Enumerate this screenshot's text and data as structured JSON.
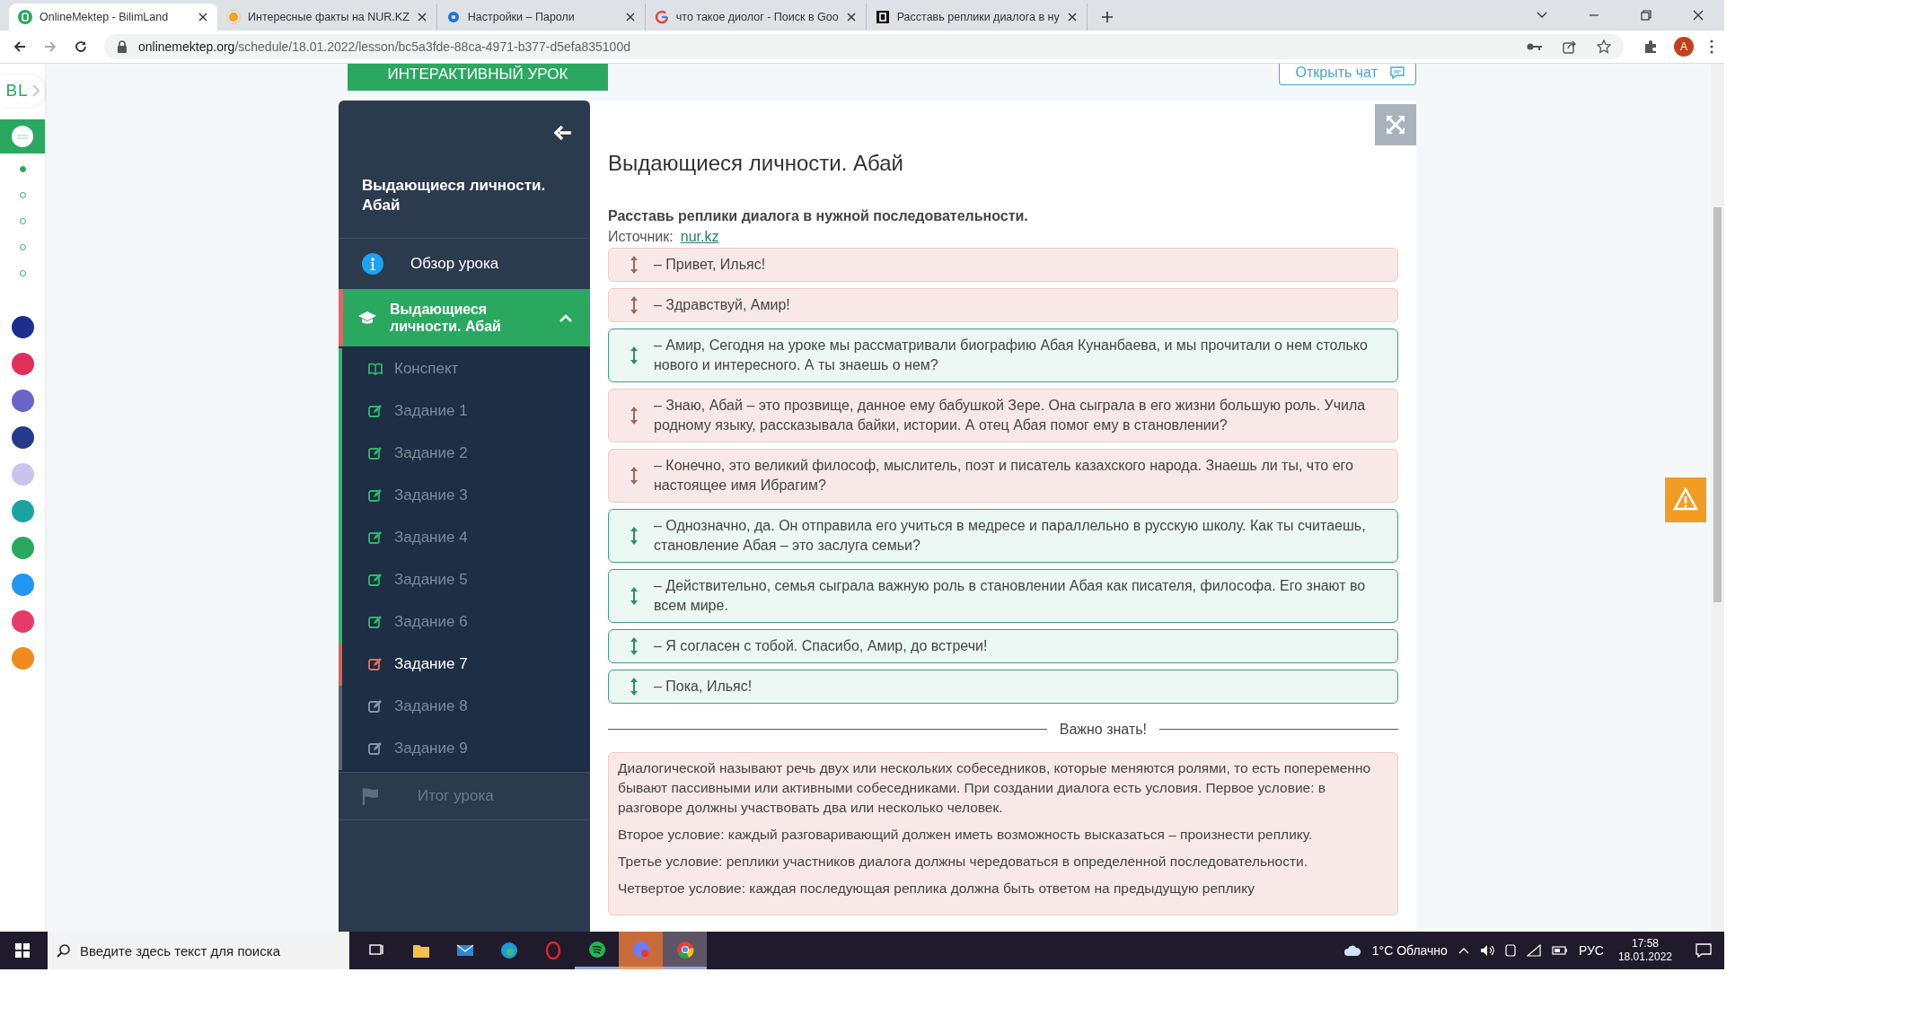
{
  "browser": {
    "tabs": [
      {
        "title": "OnlineMektep - BilimLand",
        "selected": true
      },
      {
        "title": "Интересные факты на NUR.KZ",
        "selected": false
      },
      {
        "title": "Настройки – Пароли",
        "selected": false
      },
      {
        "title": "что такое диолог - Поиск в Goo",
        "selected": false
      },
      {
        "title": "Расставь реплики диалога в ну",
        "selected": false
      }
    ],
    "url_host": "onlinemektep.org",
    "url_path": "/schedule/18.01.2022/lesson/bc5a3fde-88ca-4971-b377-d5efa835100d",
    "profile_initial": "A"
  },
  "rail": {
    "logo": "BL",
    "dots": [
      {
        "selected": true
      },
      {
        "selected": false
      },
      {
        "selected": false
      },
      {
        "selected": false
      },
      {
        "selected": false
      }
    ],
    "apps": [
      {
        "color": "#1c2f8c"
      },
      {
        "color": "#e0305a"
      },
      {
        "color": "#6a64c8"
      },
      {
        "color": "#243a8a"
      },
      {
        "color": "#c9c4ee"
      },
      {
        "color": "#1aa3a3"
      },
      {
        "color": "#2aa860"
      },
      {
        "color": "#2196f3"
      },
      {
        "color": "#e83a6a"
      },
      {
        "color": "#f08a1c"
      }
    ]
  },
  "top": {
    "interactive_button": "ИНТЕРАКТИВНЫЙ УРОК",
    "chat_button": "Открыть чат"
  },
  "sidebar": {
    "title": "Выдающиеся личности. Абай",
    "overview": "Обзор урока",
    "section": {
      "label": "Выдающиеся личности. Абай",
      "expanded": true
    },
    "items": [
      {
        "label": "Конспект",
        "kind": "notes",
        "completed": true,
        "selected": false
      },
      {
        "label": "Задание 1",
        "kind": "task",
        "completed": true,
        "selected": false
      },
      {
        "label": "Задание 2",
        "kind": "task",
        "completed": true,
        "selected": false
      },
      {
        "label": "Задание 3",
        "kind": "task",
        "completed": true,
        "selected": false
      },
      {
        "label": "Задание 4",
        "kind": "task",
        "completed": true,
        "selected": false
      },
      {
        "label": "Задание 5",
        "kind": "task",
        "completed": true,
        "selected": false
      },
      {
        "label": "Задание 6",
        "kind": "task",
        "completed": true,
        "selected": false
      },
      {
        "label": "Задание 7",
        "kind": "task",
        "completed": false,
        "selected": true
      },
      {
        "label": "Задание 8",
        "kind": "task",
        "completed": false,
        "selected": false
      },
      {
        "label": "Задание 9",
        "kind": "task",
        "completed": false,
        "selected": false
      }
    ],
    "summary": "Итог урока"
  },
  "lesson": {
    "title": "Выдающиеся личности. Абай",
    "instruction": "Расставь реплики диалога в нужной последовательности.",
    "source_label": "Источник:",
    "source_link": "nur.kz",
    "replies": [
      {
        "text": "– Привет, Ильяс!",
        "correct": false
      },
      {
        "text": "– Здравствуй, Амир!",
        "correct": false
      },
      {
        "text": "– Амир, Сегодня на уроке мы рассматривали биографию Абая Кунанбаева, и мы прочитали о нем столько нового и интересного. А ты знаешь о нем?",
        "correct": true
      },
      {
        "text": "– Знаю, Абай – это прозвище, данное ему бабушкой Зере. Она сыграла в его жизни большую роль. Учила родному языку, рассказывала байки, истории. А отец Абая помог ему в становлении?",
        "correct": false
      },
      {
        "text": "– Конечно, это великий философ, мыслитель, поэт и писатель казахского народа. Знаешь ли ты, что его настоящее имя Ибрагим?",
        "correct": false
      },
      {
        "text": "– Однозначно, да. Он отправила его учиться в медресе и параллельно в русскую школу. Как ты считаешь, становление Абая – это заслуга семьи?",
        "correct": true
      },
      {
        "text": "– Действительно, семья сыграла важную роль в становлении Абая как писателя, философа. Его знают во всем мире.",
        "correct": true
      },
      {
        "text": "– Я согласен с тобой. Спасибо, Амир, до встречи!",
        "correct": true
      },
      {
        "text": "– Пока, Ильяс!",
        "correct": true
      }
    ],
    "divider": "Важно знать!",
    "info": [
      "Диалогической называют речь двух или нескольких собеседников, которые меняются ролями, то есть попеременно бывают пассивными или активными собеседниками. При создании диалога есть условия. Первое условие: в разговоре должны участвовать два или несколько человек.",
      "Второе условие: каждый разговаривающий должен иметь возможность высказаться – произнести реплику.",
      "Третье условие: реплики участников диалога должны чередоваться в определенной последовательности.",
      "Четвертое условие: каждая последующая реплика должна быть ответом на предыдущую реплику"
    ]
  },
  "taskbar": {
    "search_placeholder": "Введите здесь текст для поиска",
    "weather": "1°C Облачно",
    "language": "РУС",
    "time": "17:58",
    "date": "18.01.2022"
  }
}
